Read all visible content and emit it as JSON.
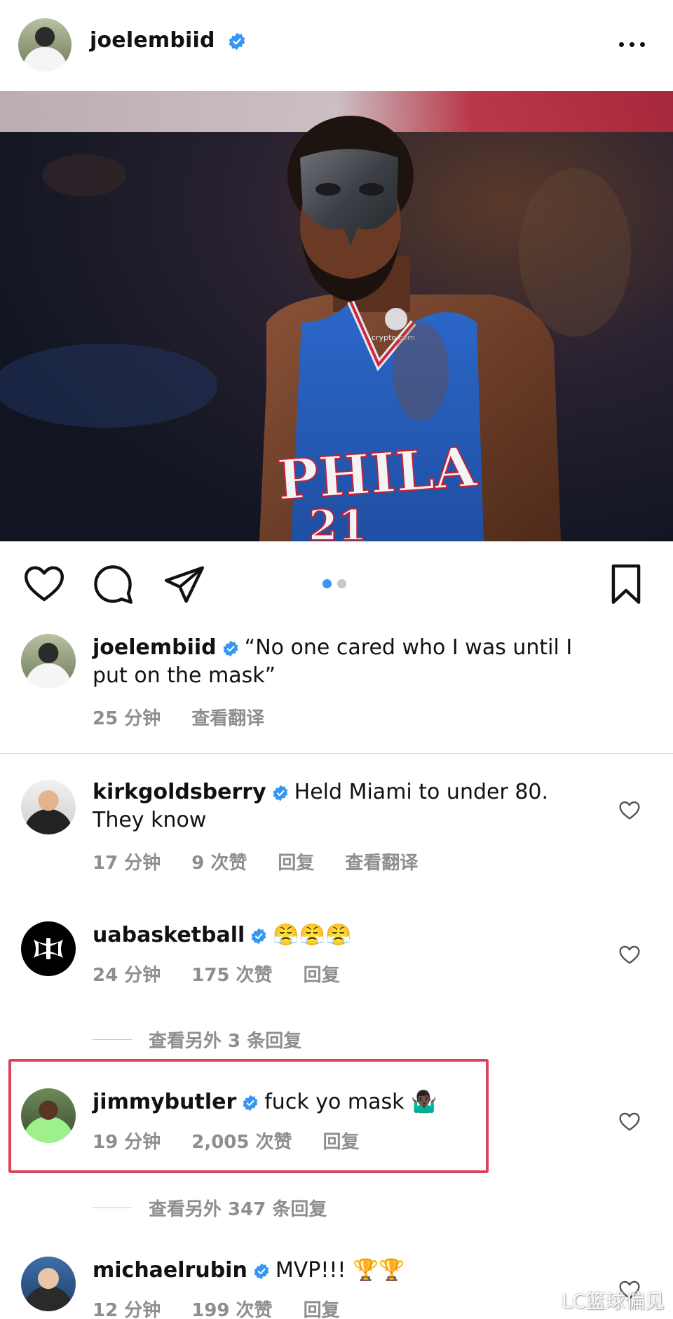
{
  "header": {
    "username": "joelembiid",
    "more_label": "more options"
  },
  "post": {
    "image_alt": "Player wearing a protective face mask in a PHILA 21 jersey",
    "carousel": {
      "count": 2,
      "active_index": 0
    },
    "jersey_text": "PHILA",
    "jersey_number": "21",
    "sponsor": "crypto.com"
  },
  "caption": {
    "username": "joelembiid",
    "text": "“No one cared who I was until I put on the mask”",
    "time": "25 分钟",
    "translate": "查看翻译"
  },
  "comments": [
    {
      "username": "kirkgoldsberry",
      "text": "Held Miami to under 80. They know",
      "time": "17 分钟",
      "likes": "9 次赞",
      "reply": "回复",
      "translate": "查看翻译"
    },
    {
      "username": "uabasketball",
      "text": "😤😤😤",
      "time": "24 分钟",
      "likes": "175 次赞",
      "reply": "回复",
      "more_replies": "查看另外 3 条回复"
    },
    {
      "username": "jimmybutler",
      "text": "fuck yo mask 🤷🏿‍♂️",
      "time": "19 分钟",
      "likes": "2,005 次赞",
      "reply": "回复",
      "more_replies": "查看另外 347 条回复"
    },
    {
      "username": "michaelrubin",
      "text": "MVP!!! 🏆🏆",
      "time": "12 分钟",
      "likes": "199 次赞",
      "reply": "回复"
    }
  ],
  "watermark": "LC篮球偏见",
  "colors": {
    "verified": "#3797f0",
    "meta_gray": "#8e8e8e",
    "highlight": "#d9445a",
    "dot_active": "#3897f0",
    "dot_inactive": "#c7c7c7"
  }
}
